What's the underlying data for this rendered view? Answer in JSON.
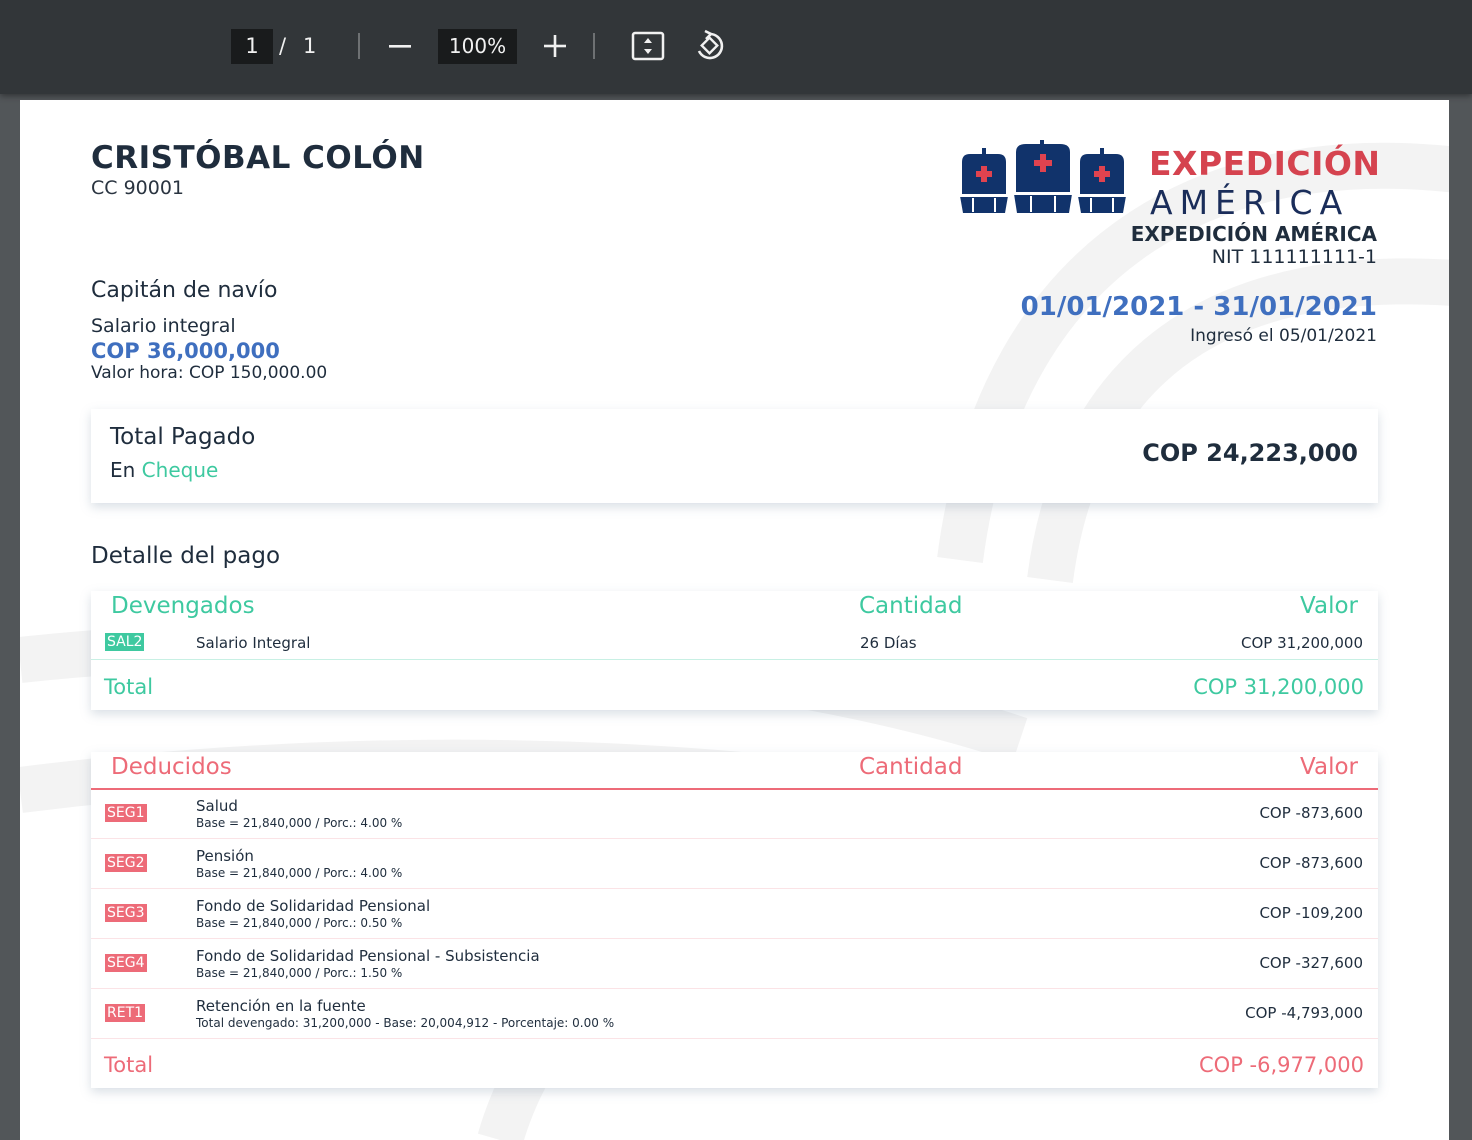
{
  "toolbar": {
    "current_page": "1",
    "page_separator": "/",
    "total_pages": "1",
    "zoom": "100%"
  },
  "employee": {
    "name": "CRISTÓBAL COLÓN",
    "id": "CC 90001",
    "job_title": "Capitán de navío",
    "salary_type": "Salario integral",
    "salary_amount": "COP 36,000,000",
    "hour_value": "Valor hora: COP 150,000.00"
  },
  "company": {
    "brand_line1": "EXPEDICIÓN",
    "brand_line2": "AMÉRICA",
    "name": "EXPEDICIÓN AMÉRICA",
    "nit": "NIT 111111111-1",
    "period": "01/01/2021 - 31/01/2021",
    "hire_date": "Ingresó el 05/01/2021"
  },
  "total_paid": {
    "label": "Total Pagado",
    "method_prefix": "En",
    "method": "Cheque",
    "amount": "COP 24,223,000"
  },
  "detail_title": "Detalle del pago",
  "accruals": {
    "header": "Devengados",
    "qty_header": "Cantidad",
    "value_header": "Valor",
    "rows": [
      {
        "code": "SAL2",
        "concept": "Salario Integral",
        "qty": "26 Días",
        "value": "COP 31,200,000"
      }
    ],
    "total_label": "Total",
    "total_value": "COP 31,200,000"
  },
  "deductions": {
    "header": "Deducidos",
    "qty_header": "Cantidad",
    "value_header": "Valor",
    "rows": [
      {
        "code": "SEG1",
        "concept": "Salud",
        "detail": "Base = 21,840,000 / Porc.: 4.00 %",
        "value": "COP -873,600"
      },
      {
        "code": "SEG2",
        "concept": "Pensión",
        "detail": "Base = 21,840,000 / Porc.: 4.00 %",
        "value": "COP -873,600"
      },
      {
        "code": "SEG3",
        "concept": "Fondo de Solidaridad Pensional",
        "detail": "Base = 21,840,000 / Porc.: 0.50 %",
        "value": "COP -109,200"
      },
      {
        "code": "SEG4",
        "concept": "Fondo de Solidaridad Pensional - Subsistencia",
        "detail": "Base = 21,840,000 / Porc.: 1.50 %",
        "value": "COP -327,600"
      },
      {
        "code": "RET1",
        "concept": "Retención en la fuente",
        "detail": "Total devengado: 31,200,000 - Base: 20,004,912 - Porcentaje: 0.00 %",
        "value": "COP -4,793,000"
      }
    ],
    "total_label": "Total",
    "total_value": "COP -6,977,000"
  },
  "colors": {
    "accent_blue": "#3f6fbf",
    "accent_green": "#3ec9a0",
    "accent_red": "#ed6b78",
    "brand_red": "#d5434f",
    "brand_navy": "#1a2d5a"
  }
}
